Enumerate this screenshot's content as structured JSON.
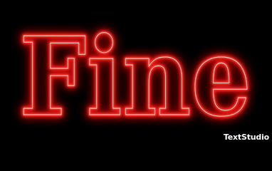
{
  "logo": {
    "word": "Fine",
    "style": "red-neon-outline",
    "glow_color": "#ff1a1a",
    "core_color": "#ffd0c8",
    "background_color": "#000000"
  },
  "watermark": {
    "text": "TextStudio",
    "color": "#ffffff"
  }
}
